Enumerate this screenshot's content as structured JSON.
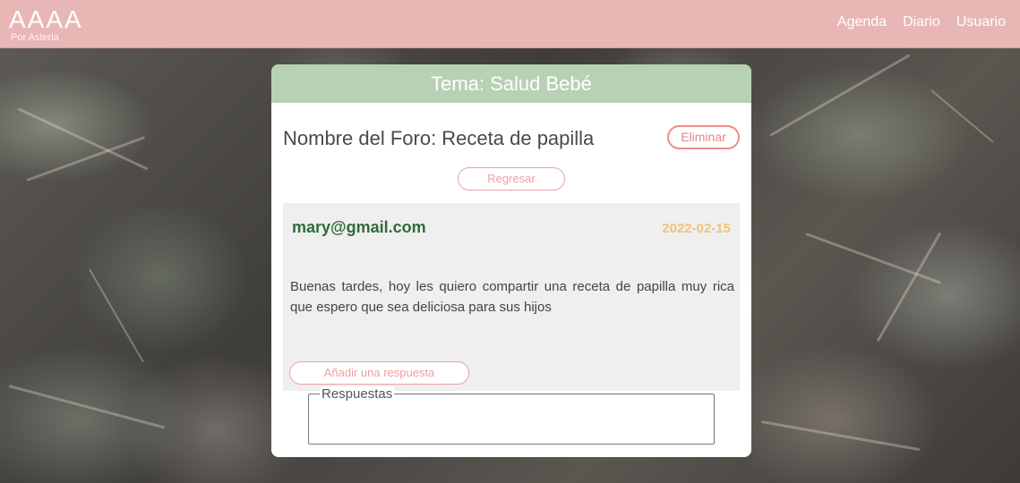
{
  "brand": {
    "title": "AAAA",
    "subtitle": "Por Asteria"
  },
  "nav": {
    "items": [
      {
        "label": "Agenda"
      },
      {
        "label": "Diario"
      },
      {
        "label": "Usuario"
      }
    ]
  },
  "card": {
    "header": "Tema: Salud Bebé",
    "forum_title": "Nombre del Foro: Receta de papilla",
    "delete_label": "Eliminar",
    "back_label": "Regresar"
  },
  "post": {
    "author": "mary@gmail.com",
    "date": "2022-02-15",
    "body": "Buenas tardes, hoy les quiero compartir una receta de papilla muy rica que espero que sea deliciosa para sus hijos",
    "reply_label": "Añadir una respuesta"
  },
  "responses": {
    "legend": "Respuestas"
  },
  "colors": {
    "topbar": "#e9b6b6",
    "card_header": "#b7d1b5",
    "author": "#2e6b3a",
    "date": "#f2c27a",
    "accent_pink": "#f08a8a"
  }
}
